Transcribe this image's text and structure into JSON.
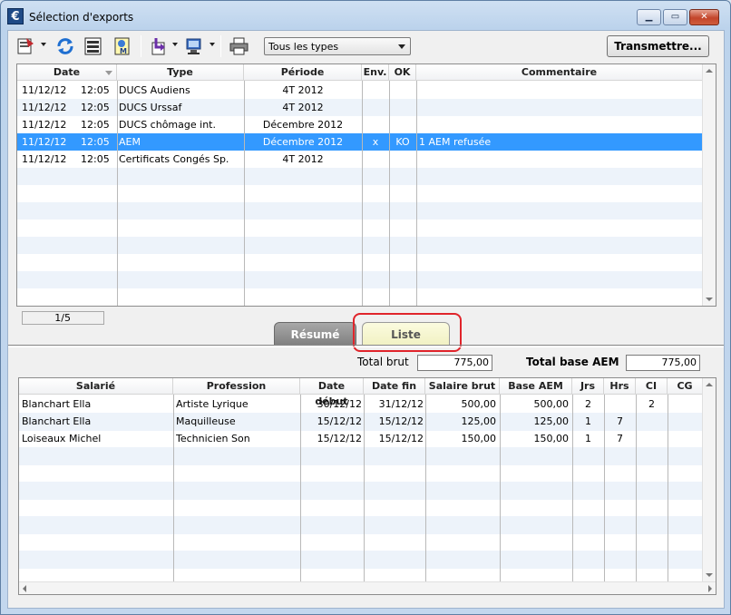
{
  "window": {
    "title": "Sélection d'exports",
    "app_icon": "€"
  },
  "toolbar": {
    "filter_value": "Tous les types",
    "transmit_label": "Transmettre...",
    "icons": [
      "export-menu-icon",
      "refresh-icon",
      "list-icon",
      "document-m-icon",
      "move-menu-icon",
      "send-menu-icon",
      "printer-icon"
    ]
  },
  "exports": {
    "headers": {
      "date": "Date",
      "type": "Type",
      "period": "Période",
      "env": "Env.",
      "ok": "OK",
      "comment": "Commentaire"
    },
    "rows": [
      {
        "date": "11/12/12",
        "time": "12:05",
        "type": "DUCS Audiens",
        "period": "4T 2012",
        "env": "",
        "ok": "",
        "comment": ""
      },
      {
        "date": "11/12/12",
        "time": "12:05",
        "type": "DUCS Urssaf",
        "period": "4T 2012",
        "env": "",
        "ok": "",
        "comment": ""
      },
      {
        "date": "11/12/12",
        "time": "12:05",
        "type": "DUCS chômage int.",
        "period": "Décembre 2012",
        "env": "",
        "ok": "",
        "comment": ""
      },
      {
        "date": "11/12/12",
        "time": "12:05",
        "type": "AEM",
        "period": "Décembre 2012",
        "env": "x",
        "ok": "KO",
        "comment": "1 AEM refusée"
      },
      {
        "date": "11/12/12",
        "time": "12:05",
        "type": "Certificats Congés Sp.",
        "period": "4T 2012",
        "env": "",
        "ok": "",
        "comment": ""
      }
    ],
    "selected_index": 3,
    "page_count": "1/5"
  },
  "tabs": {
    "resume": "Résumé",
    "liste": "Liste",
    "active": "liste"
  },
  "totals": {
    "brut_label": "Total brut",
    "brut_value": "775,00",
    "aem_label": "Total base AEM",
    "aem_value": "775,00"
  },
  "details": {
    "headers": {
      "salarie": "Salarié",
      "profession": "Profession",
      "date_debut": "Date début",
      "date_fin": "Date fin",
      "salaire_brut": "Salaire brut",
      "base_aem": "Base AEM",
      "jrs": "Jrs",
      "hrs": "Hrs",
      "ci": "CI",
      "cg": "CG"
    },
    "rows": [
      {
        "salarie": "Blanchart Ella",
        "profession": "Artiste Lyrique",
        "date_debut": "30/12/12",
        "date_fin": "31/12/12",
        "salaire_brut": "500,00",
        "base_aem": "500,00",
        "jrs": "2",
        "hrs": "",
        "ci": "2",
        "cg": ""
      },
      {
        "salarie": "Blanchart Ella",
        "profession": "Maquilleuse",
        "date_debut": "15/12/12",
        "date_fin": "15/12/12",
        "salaire_brut": "125,00",
        "base_aem": "125,00",
        "jrs": "1",
        "hrs": "7",
        "ci": "",
        "cg": ""
      },
      {
        "salarie": "Loiseaux Michel",
        "profession": "Technicien Son",
        "date_debut": "15/12/12",
        "date_fin": "15/12/12",
        "salaire_brut": "150,00",
        "base_aem": "150,00",
        "jrs": "1",
        "hrs": "7",
        "ci": "",
        "cg": ""
      }
    ]
  }
}
